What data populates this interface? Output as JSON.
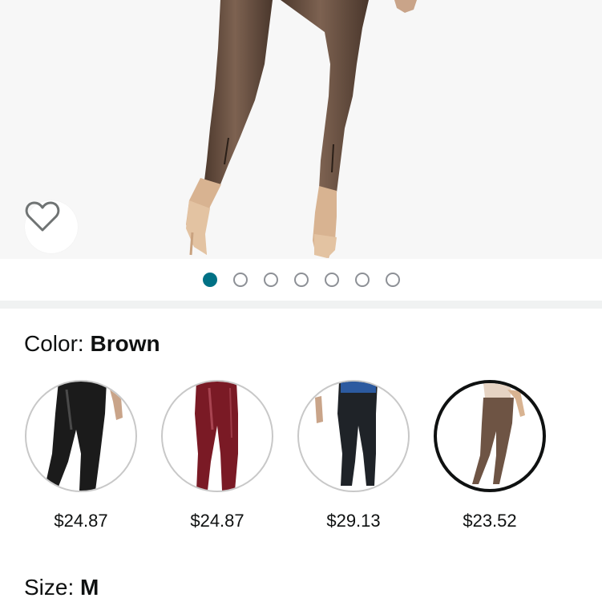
{
  "colors": {
    "active_dot": "#007185",
    "pants_brown": "#6e5444",
    "pants_black": "#1b1b1b",
    "pants_red": "#7a1a25"
  },
  "carousel": {
    "image_count": 7,
    "active_index": 0
  },
  "color_selector": {
    "label": "Color:",
    "value": "Brown"
  },
  "variants": [
    {
      "name": "black-faux-leather",
      "price": "$24.87",
      "selected": false
    },
    {
      "name": "burgundy-faux-leather",
      "price": "$24.87",
      "selected": false
    },
    {
      "name": "black-split-hem",
      "price": "$29.13",
      "selected": false
    },
    {
      "name": "brown",
      "price": "$23.52",
      "selected": true
    }
  ],
  "size_selector": {
    "label": "Size:",
    "value": "M"
  }
}
